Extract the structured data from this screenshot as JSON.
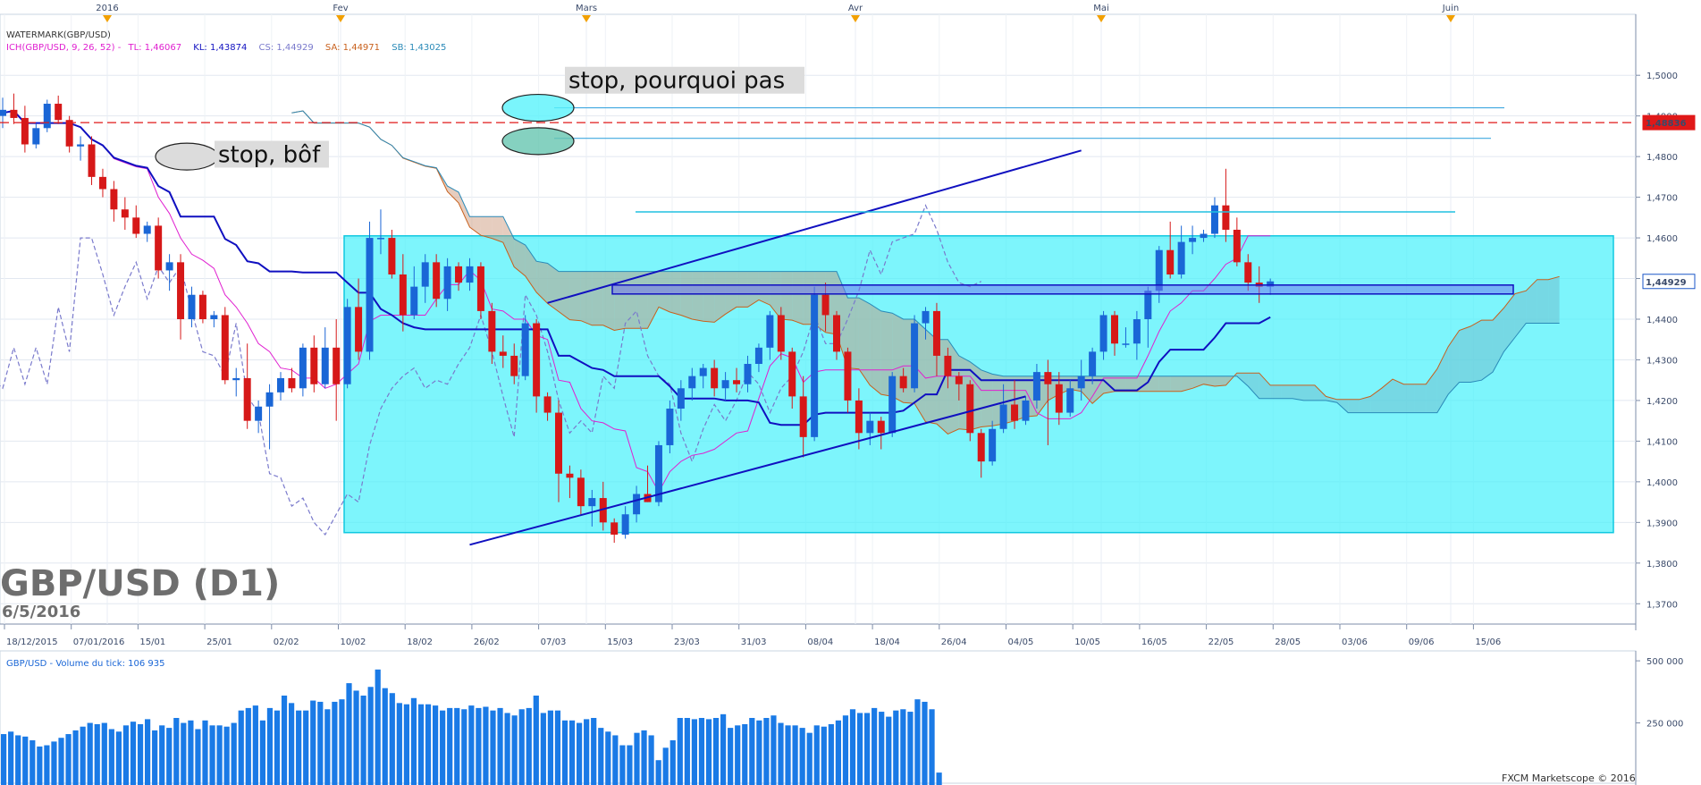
{
  "chart_data": {
    "type": "candlestick",
    "symbol": "GBP/USD",
    "title": "GBP/USD (D1)",
    "date_label": "6/5/2016",
    "watermark": "WATERMARK(GBP/USD)",
    "ylim": [
      1.365,
      1.515
    ],
    "ytick_labels": [
      "1,3700",
      "1,3800",
      "1,3900",
      "1,4000",
      "1,4100",
      "1,4200",
      "1,4300",
      "1,4400",
      "1,4500",
      "1,4600",
      "1,4700",
      "1,4800",
      "1,4900",
      "1,5000"
    ],
    "yticks": [
      1.37,
      1.38,
      1.39,
      1.4,
      1.41,
      1.42,
      1.43,
      1.44,
      1.45,
      1.46,
      1.47,
      1.48,
      1.49,
      1.5
    ],
    "xtick_labels": [
      "18/12/2015",
      "07/01/2016",
      "15/01",
      "25/01",
      "02/02",
      "10/02",
      "18/02",
      "26/02",
      "07/03",
      "15/03",
      "23/03",
      "31/03",
      "08/04",
      "18/04",
      "26/04",
      "04/05",
      "10/05",
      "16/05",
      "22/05",
      "28/05",
      "03/06",
      "09/06",
      "15/06"
    ],
    "month_labels": [
      "2016",
      "Fev",
      "Mars",
      "Avr",
      "Mai",
      "Juin"
    ],
    "ichimoku_legend": {
      "prefix": "ICH(GBP/USD, 9, 26, 52) -",
      "tl": "TL: 1,46067",
      "kl": "KL: 1,43874",
      "cs": "CS: 1,44929",
      "sa": "SA: 1,44971",
      "sb": "SB: 1,43025"
    },
    "price_markers": [
      {
        "label": "1,48836",
        "value": 1.48836,
        "color": "#e01818"
      },
      {
        "label": "1,44929",
        "value": 1.44929,
        "color": "#1a56c8"
      }
    ],
    "annotations": [
      "stop, pourquoi pas",
      "stop, bôf"
    ],
    "candles": [
      {
        "o": 1.49,
        "h": 1.4945,
        "l": 1.487,
        "c": 1.4915
      },
      {
        "o": 1.4915,
        "h": 1.4955,
        "l": 1.488,
        "c": 1.4895
      },
      {
        "o": 1.4895,
        "h": 1.4925,
        "l": 1.481,
        "c": 1.483
      },
      {
        "o": 1.483,
        "h": 1.488,
        "l": 1.482,
        "c": 1.487
      },
      {
        "o": 1.487,
        "h": 1.494,
        "l": 1.486,
        "c": 1.493
      },
      {
        "o": 1.493,
        "h": 1.495,
        "l": 1.488,
        "c": 1.489
      },
      {
        "o": 1.489,
        "h": 1.49,
        "l": 1.481,
        "c": 1.4825
      },
      {
        "o": 1.4825,
        "h": 1.485,
        "l": 1.479,
        "c": 1.483
      },
      {
        "o": 1.483,
        "h": 1.485,
        "l": 1.473,
        "c": 1.475
      },
      {
        "o": 1.475,
        "h": 1.477,
        "l": 1.47,
        "c": 1.472
      },
      {
        "o": 1.472,
        "h": 1.474,
        "l": 1.464,
        "c": 1.467
      },
      {
        "o": 1.467,
        "h": 1.47,
        "l": 1.462,
        "c": 1.465
      },
      {
        "o": 1.465,
        "h": 1.468,
        "l": 1.46,
        "c": 1.461
      },
      {
        "o": 1.461,
        "h": 1.464,
        "l": 1.459,
        "c": 1.463
      },
      {
        "o": 1.463,
        "h": 1.465,
        "l": 1.45,
        "c": 1.452
      },
      {
        "o": 1.452,
        "h": 1.456,
        "l": 1.447,
        "c": 1.454
      },
      {
        "o": 1.454,
        "h": 1.456,
        "l": 1.435,
        "c": 1.44
      },
      {
        "o": 1.44,
        "h": 1.448,
        "l": 1.438,
        "c": 1.446
      },
      {
        "o": 1.446,
        "h": 1.447,
        "l": 1.439,
        "c": 1.44
      },
      {
        "o": 1.44,
        "h": 1.442,
        "l": 1.438,
        "c": 1.441
      },
      {
        "o": 1.441,
        "h": 1.443,
        "l": 1.424,
        "c": 1.425
      },
      {
        "o": 1.425,
        "h": 1.428,
        "l": 1.421,
        "c": 1.4255
      },
      {
        "o": 1.4255,
        "h": 1.434,
        "l": 1.413,
        "c": 1.415
      },
      {
        "o": 1.415,
        "h": 1.42,
        "l": 1.412,
        "c": 1.4185
      },
      {
        "o": 1.4185,
        "h": 1.424,
        "l": 1.408,
        "c": 1.422
      },
      {
        "o": 1.422,
        "h": 1.427,
        "l": 1.42,
        "c": 1.4255
      },
      {
        "o": 1.4255,
        "h": 1.428,
        "l": 1.422,
        "c": 1.423
      },
      {
        "o": 1.423,
        "h": 1.434,
        "l": 1.421,
        "c": 1.433
      },
      {
        "o": 1.433,
        "h": 1.436,
        "l": 1.422,
        "c": 1.424
      },
      {
        "o": 1.424,
        "h": 1.438,
        "l": 1.423,
        "c": 1.433
      },
      {
        "o": 1.433,
        "h": 1.44,
        "l": 1.415,
        "c": 1.424
      },
      {
        "o": 1.424,
        "h": 1.445,
        "l": 1.423,
        "c": 1.443
      },
      {
        "o": 1.443,
        "h": 1.45,
        "l": 1.43,
        "c": 1.432
      },
      {
        "o": 1.432,
        "h": 1.464,
        "l": 1.43,
        "c": 1.46
      },
      {
        "o": 1.46,
        "h": 1.467,
        "l": 1.456,
        "c": 1.46
      },
      {
        "o": 1.46,
        "h": 1.462,
        "l": 1.45,
        "c": 1.451
      },
      {
        "o": 1.451,
        "h": 1.456,
        "l": 1.437,
        "c": 1.441
      },
      {
        "o": 1.441,
        "h": 1.453,
        "l": 1.44,
        "c": 1.448
      },
      {
        "o": 1.448,
        "h": 1.456,
        "l": 1.444,
        "c": 1.454
      },
      {
        "o": 1.454,
        "h": 1.456,
        "l": 1.443,
        "c": 1.445
      },
      {
        "o": 1.445,
        "h": 1.455,
        "l": 1.442,
        "c": 1.453
      },
      {
        "o": 1.453,
        "h": 1.454,
        "l": 1.447,
        "c": 1.449
      },
      {
        "o": 1.449,
        "h": 1.455,
        "l": 1.447,
        "c": 1.453
      },
      {
        "o": 1.453,
        "h": 1.454,
        "l": 1.44,
        "c": 1.442
      },
      {
        "o": 1.442,
        "h": 1.444,
        "l": 1.429,
        "c": 1.432
      },
      {
        "o": 1.432,
        "h": 1.436,
        "l": 1.428,
        "c": 1.431
      },
      {
        "o": 1.431,
        "h": 1.434,
        "l": 1.424,
        "c": 1.426
      },
      {
        "o": 1.426,
        "h": 1.441,
        "l": 1.425,
        "c": 1.439
      },
      {
        "o": 1.439,
        "h": 1.44,
        "l": 1.417,
        "c": 1.421
      },
      {
        "o": 1.421,
        "h": 1.422,
        "l": 1.415,
        "c": 1.417
      },
      {
        "o": 1.417,
        "h": 1.42,
        "l": 1.395,
        "c": 1.402
      },
      {
        "o": 1.402,
        "h": 1.404,
        "l": 1.396,
        "c": 1.401
      },
      {
        "o": 1.401,
        "h": 1.403,
        "l": 1.392,
        "c": 1.394
      },
      {
        "o": 1.394,
        "h": 1.398,
        "l": 1.389,
        "c": 1.396
      },
      {
        "o": 1.396,
        "h": 1.4,
        "l": 1.388,
        "c": 1.39
      },
      {
        "o": 1.39,
        "h": 1.391,
        "l": 1.385,
        "c": 1.387
      },
      {
        "o": 1.387,
        "h": 1.394,
        "l": 1.386,
        "c": 1.392
      },
      {
        "o": 1.392,
        "h": 1.399,
        "l": 1.39,
        "c": 1.397
      },
      {
        "o": 1.397,
        "h": 1.404,
        "l": 1.395,
        "c": 1.395
      },
      {
        "o": 1.395,
        "h": 1.41,
        "l": 1.394,
        "c": 1.409
      },
      {
        "o": 1.409,
        "h": 1.42,
        "l": 1.407,
        "c": 1.418
      },
      {
        "o": 1.418,
        "h": 1.425,
        "l": 1.415,
        "c": 1.423
      },
      {
        "o": 1.423,
        "h": 1.428,
        "l": 1.42,
        "c": 1.426
      },
      {
        "o": 1.426,
        "h": 1.429,
        "l": 1.423,
        "c": 1.428
      },
      {
        "o": 1.428,
        "h": 1.43,
        "l": 1.421,
        "c": 1.423
      },
      {
        "o": 1.423,
        "h": 1.427,
        "l": 1.42,
        "c": 1.425
      },
      {
        "o": 1.425,
        "h": 1.428,
        "l": 1.422,
        "c": 1.424
      },
      {
        "o": 1.424,
        "h": 1.431,
        "l": 1.422,
        "c": 1.429
      },
      {
        "o": 1.429,
        "h": 1.434,
        "l": 1.427,
        "c": 1.433
      },
      {
        "o": 1.433,
        "h": 1.442,
        "l": 1.43,
        "c": 1.441
      },
      {
        "o": 1.441,
        "h": 1.443,
        "l": 1.43,
        "c": 1.432
      },
      {
        "o": 1.432,
        "h": 1.433,
        "l": 1.418,
        "c": 1.421
      },
      {
        "o": 1.421,
        "h": 1.426,
        "l": 1.406,
        "c": 1.411
      },
      {
        "o": 1.411,
        "h": 1.448,
        "l": 1.41,
        "c": 1.446
      },
      {
        "o": 1.446,
        "h": 1.449,
        "l": 1.437,
        "c": 1.441
      },
      {
        "o": 1.441,
        "h": 1.442,
        "l": 1.43,
        "c": 1.432
      },
      {
        "o": 1.432,
        "h": 1.433,
        "l": 1.417,
        "c": 1.42
      },
      {
        "o": 1.42,
        "h": 1.423,
        "l": 1.408,
        "c": 1.412
      },
      {
        "o": 1.412,
        "h": 1.417,
        "l": 1.409,
        "c": 1.415
      },
      {
        "o": 1.415,
        "h": 1.416,
        "l": 1.408,
        "c": 1.412
      },
      {
        "o": 1.412,
        "h": 1.427,
        "l": 1.411,
        "c": 1.426
      },
      {
        "o": 1.426,
        "h": 1.428,
        "l": 1.422,
        "c": 1.423
      },
      {
        "o": 1.423,
        "h": 1.441,
        "l": 1.422,
        "c": 1.439
      },
      {
        "o": 1.439,
        "h": 1.443,
        "l": 1.435,
        "c": 1.442
      },
      {
        "o": 1.442,
        "h": 1.444,
        "l": 1.426,
        "c": 1.431
      },
      {
        "o": 1.431,
        "h": 1.433,
        "l": 1.423,
        "c": 1.426
      },
      {
        "o": 1.426,
        "h": 1.427,
        "l": 1.42,
        "c": 1.424
      },
      {
        "o": 1.424,
        "h": 1.425,
        "l": 1.41,
        "c": 1.412
      },
      {
        "o": 1.412,
        "h": 1.413,
        "l": 1.401,
        "c": 1.405
      },
      {
        "o": 1.405,
        "h": 1.415,
        "l": 1.404,
        "c": 1.413
      },
      {
        "o": 1.413,
        "h": 1.424,
        "l": 1.412,
        "c": 1.419
      },
      {
        "o": 1.419,
        "h": 1.425,
        "l": 1.413,
        "c": 1.415
      },
      {
        "o": 1.415,
        "h": 1.421,
        "l": 1.414,
        "c": 1.42
      },
      {
        "o": 1.42,
        "h": 1.429,
        "l": 1.418,
        "c": 1.427
      },
      {
        "o": 1.427,
        "h": 1.43,
        "l": 1.409,
        "c": 1.424
      },
      {
        "o": 1.424,
        "h": 1.427,
        "l": 1.414,
        "c": 1.417
      },
      {
        "o": 1.417,
        "h": 1.425,
        "l": 1.416,
        "c": 1.423
      },
      {
        "o": 1.423,
        "h": 1.43,
        "l": 1.42,
        "c": 1.426
      },
      {
        "o": 1.426,
        "h": 1.433,
        "l": 1.424,
        "c": 1.432
      },
      {
        "o": 1.432,
        "h": 1.442,
        "l": 1.43,
        "c": 1.441
      },
      {
        "o": 1.441,
        "h": 1.442,
        "l": 1.431,
        "c": 1.434
      },
      {
        "o": 1.434,
        "h": 1.438,
        "l": 1.433,
        "c": 1.434
      },
      {
        "o": 1.434,
        "h": 1.442,
        "l": 1.43,
        "c": 1.44
      },
      {
        "o": 1.44,
        "h": 1.448,
        "l": 1.433,
        "c": 1.447
      },
      {
        "o": 1.447,
        "h": 1.458,
        "l": 1.444,
        "c": 1.457
      },
      {
        "o": 1.457,
        "h": 1.464,
        "l": 1.45,
        "c": 1.451
      },
      {
        "o": 1.451,
        "h": 1.463,
        "l": 1.45,
        "c": 1.459
      },
      {
        "o": 1.459,
        "h": 1.463,
        "l": 1.456,
        "c": 1.46
      },
      {
        "o": 1.46,
        "h": 1.462,
        "l": 1.459,
        "c": 1.461
      },
      {
        "o": 1.461,
        "h": 1.47,
        "l": 1.46,
        "c": 1.468
      },
      {
        "o": 1.468,
        "h": 1.477,
        "l": 1.459,
        "c": 1.462
      },
      {
        "o": 1.462,
        "h": 1.465,
        "l": 1.453,
        "c": 1.454
      },
      {
        "o": 1.454,
        "h": 1.456,
        "l": 1.447,
        "c": 1.449
      },
      {
        "o": 1.449,
        "h": 1.453,
        "l": 1.444,
        "c": 1.448
      },
      {
        "o": 1.448,
        "h": 1.45,
        "l": 1.446,
        "c": 1.4493
      }
    ],
    "volume": {
      "label": "GBP/USD - Volume du tick: 106 935",
      "ytick_labels": [
        "250 000",
        "500 000"
      ],
      "yticks": [
        250000,
        500000
      ],
      "ylim": [
        0,
        540000
      ],
      "values": [
        205000,
        215000,
        200000,
        195000,
        180000,
        155000,
        160000,
        175000,
        190000,
        205000,
        220000,
        235000,
        250000,
        245000,
        250000,
        225000,
        215000,
        240000,
        255000,
        245000,
        265000,
        220000,
        240000,
        230000,
        270000,
        250000,
        260000,
        225000,
        260000,
        240000,
        240000,
        235000,
        250000,
        300000,
        310000,
        320000,
        260000,
        310000,
        300000,
        360000,
        330000,
        300000,
        300000,
        340000,
        335000,
        305000,
        335000,
        345000,
        410000,
        380000,
        360000,
        395000,
        465000,
        390000,
        370000,
        330000,
        325000,
        350000,
        325000,
        325000,
        320000,
        300000,
        310000,
        310000,
        305000,
        320000,
        310000,
        315000,
        300000,
        310000,
        290000,
        280000,
        305000,
        310000,
        360000,
        290000,
        300000,
        300000,
        260000,
        260000,
        250000,
        265000,
        270000,
        230000,
        215000,
        200000,
        160000,
        160000,
        210000,
        220000,
        200000,
        100000,
        150000,
        180000,
        270000,
        270000,
        265000,
        270000,
        265000,
        270000,
        285000,
        230000,
        240000,
        245000,
        270000,
        260000,
        270000,
        280000,
        250000,
        240000,
        240000,
        230000,
        210000,
        240000,
        235000,
        245000,
        260000,
        280000,
        305000,
        290000,
        290000,
        310000,
        295000,
        275000,
        300000,
        305000,
        295000,
        345000,
        335000,
        305000,
        50000
      ]
    },
    "credit": "FXCM Marketscope © 2016"
  },
  "colors": {
    "bull": "#1a66d6",
    "bear": "#d61818",
    "kijun": "#1010c0",
    "tenkan": "#e020d0",
    "chikou": "#7a7acc",
    "kumo_bear": "#f6c4b0",
    "kumo_bull": "#b0e0e8",
    "zone": "#59f3fb"
  }
}
